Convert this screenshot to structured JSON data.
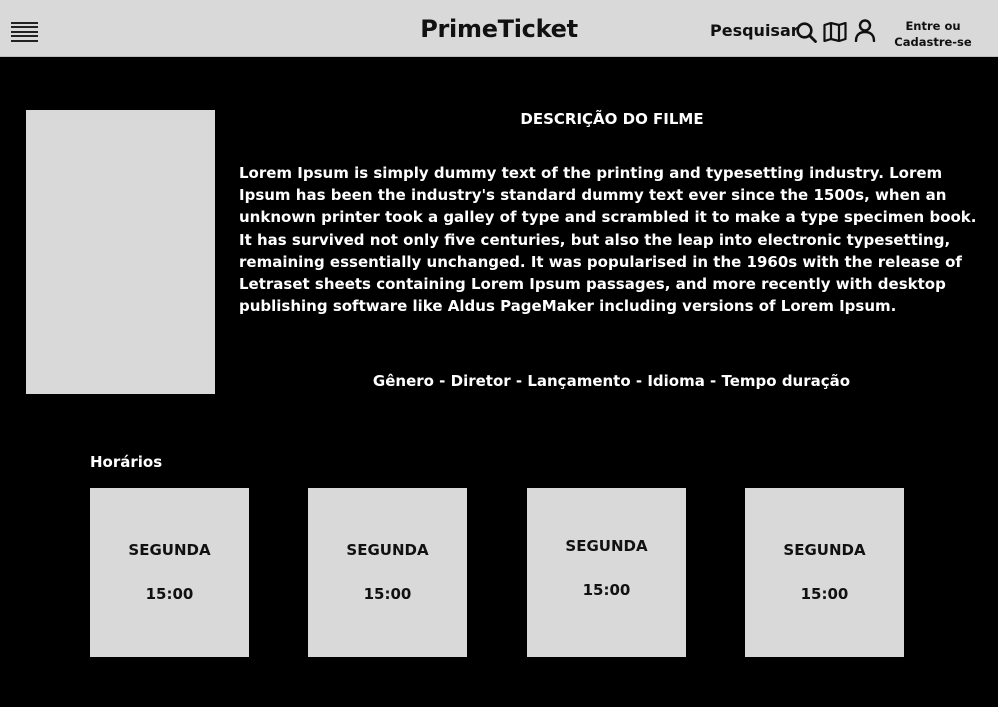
{
  "header": {
    "brand": "PrimeTicket",
    "search_label": "Pesquisar",
    "login_line1": "Entre ou",
    "login_line2": "Cadastre-se",
    "icons": [
      "menu-icon",
      "search-icon",
      "map-icon",
      "user-icon"
    ]
  },
  "movie": {
    "title": "DESCRIÇÃO DO FILME",
    "description": "Lorem Ipsum is simply dummy text of the printing and typesetting industry. Lorem Ipsum has been the industry's standard dummy text ever since the 1500s, when an unknown printer took a galley of type and scrambled it to make a type specimen book. It has survived not only five centuries, but also the leap into electronic typesetting, remaining essentially unchanged. It was popularised in the 1960s with the release of Letraset sheets containing Lorem Ipsum passages, and more recently with desktop publishing software like Aldus PageMaker including versions of Lorem Ipsum.",
    "meta": "Gênero - Diretor - Lançamento - Idioma - Tempo duração"
  },
  "schedule": {
    "title": "Horários",
    "cards": [
      {
        "day": "SEGUNDA",
        "time": "15:00"
      },
      {
        "day": "SEGUNDA",
        "time": "15:00"
      },
      {
        "day": "SEGUNDA",
        "time": "15:00"
      },
      {
        "day": "SEGUNDA",
        "time": "15:00"
      }
    ]
  },
  "colors": {
    "background": "#000000",
    "header": "#d9d9d9",
    "placeholder": "#d9d9d9",
    "text_light": "#ffffff",
    "text_dark": "#111111"
  }
}
